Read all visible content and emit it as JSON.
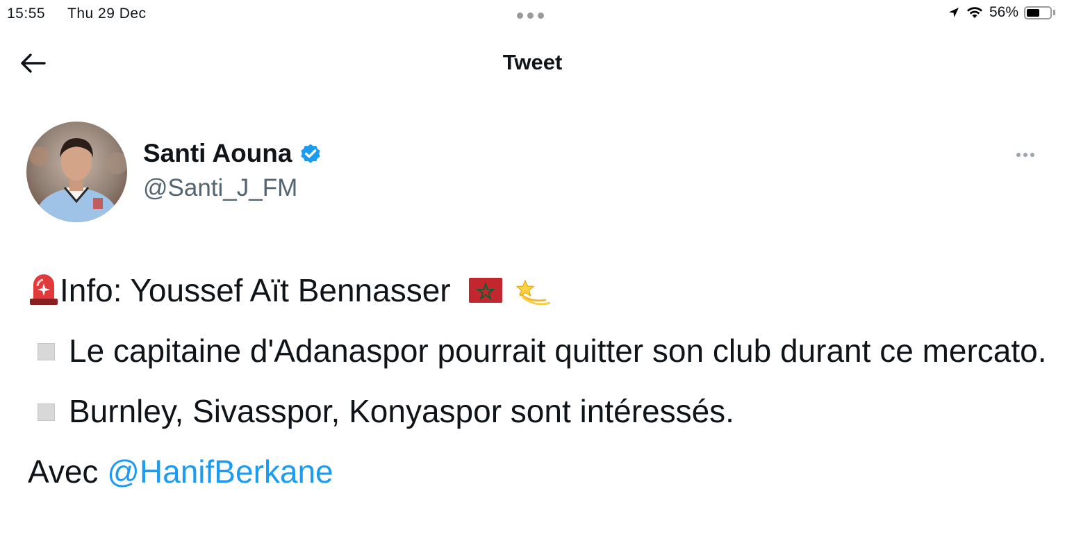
{
  "status_bar": {
    "time": "15:55",
    "date": "Thu 29 Dec",
    "battery_percent": "56%",
    "battery_level": 0.56,
    "icons": [
      "location-arrow-icon",
      "wifi-icon",
      "battery-icon"
    ]
  },
  "header": {
    "title": "Tweet",
    "back_icon": "arrow-left-icon"
  },
  "author": {
    "name": "Santi Aouna",
    "handle": "@Santi_J_FM",
    "verified": true,
    "verified_color": "#1d9bf0"
  },
  "tweet": {
    "line1": "Info: Youssef Aït Bennasser",
    "line1_emojis": [
      "rotating-light-icon",
      "morocco-flag-icon",
      "dizzy-star-icon"
    ],
    "line2": "Le capitaine d'Adanaspor pourrait quitter son club durant ce mercato.",
    "line3": "Burnley, Sivasspor, Konyaspor sont intéressés.",
    "line4_prefix": "Avec",
    "line4_mention": "@HanifBerkane"
  },
  "colors": {
    "text": "#0f1419",
    "secondary": "#536471",
    "link": "#1d9bf0"
  }
}
